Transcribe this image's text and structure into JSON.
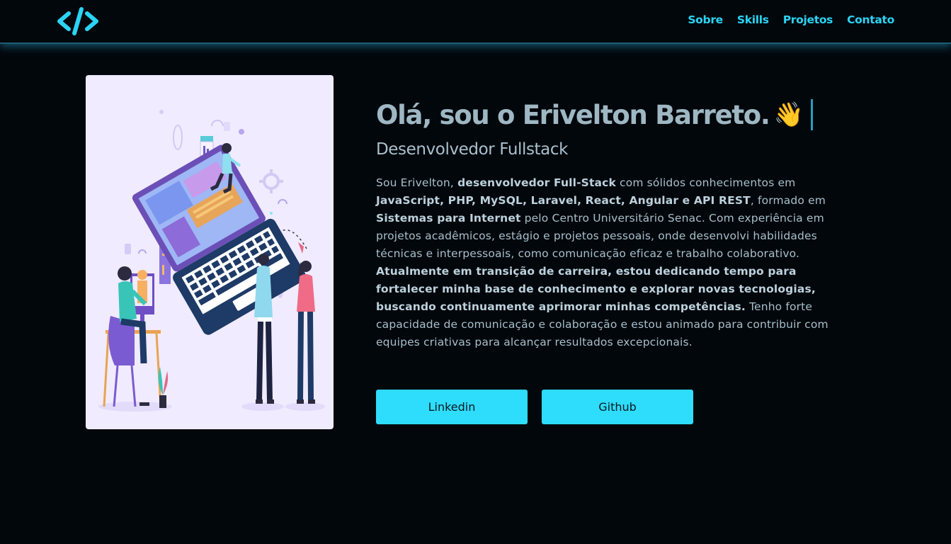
{
  "nav": {
    "logo_icon": "code-brackets-icon",
    "links": [
      "Sobre",
      "Skills",
      "Projetos",
      "Contato"
    ]
  },
  "hero": {
    "image_alt": "developer illustration",
    "heading": "Olá, sou o Erivelton Barreto.",
    "wave_emoji": "👋",
    "subtitle": "Desenvolvedor Fullstack",
    "bio": [
      {
        "t": "Sou Erivelton, ",
        "b": false
      },
      {
        "t": "desenvolvedor Full-Stack",
        "b": true
      },
      {
        "t": " com sólidos conhecimentos em ",
        "b": false
      },
      {
        "t": "JavaScript, PHP, MySQL, Laravel, React, Angular e API REST",
        "b": true
      },
      {
        "t": ", formado em ",
        "b": false
      },
      {
        "t": "Sistemas para Internet",
        "b": true
      },
      {
        "t": " pelo Centro Universitário Senac. Com experiência em projetos acadêmicos, estágio e projetos pessoais, onde desenvolvi habilidades técnicas e interpessoais, como comunicação eficaz e trabalho colaborativo. ",
        "b": false
      },
      {
        "t": "Atualmente em transição de carreira, estou dedicando tempo para fortalecer minha base de conhecimento e explorar novas tecnologias, buscando continuamente aprimorar minhas competências.",
        "b": true
      },
      {
        "t": " Tenho forte capacidade de comunicação e colaboração e estou animado para contribuir com equipes criativas para alcançar resultados excepcionais.",
        "b": false
      }
    ],
    "buttons": {
      "linkedin": "Linkedin",
      "github": "Github"
    }
  },
  "colors": {
    "background": "#02070c",
    "accent": "#2edcfb",
    "nav_link": "#2ad4f5",
    "heading": "#9eb7c3",
    "card_bg": "#f0ebff"
  }
}
